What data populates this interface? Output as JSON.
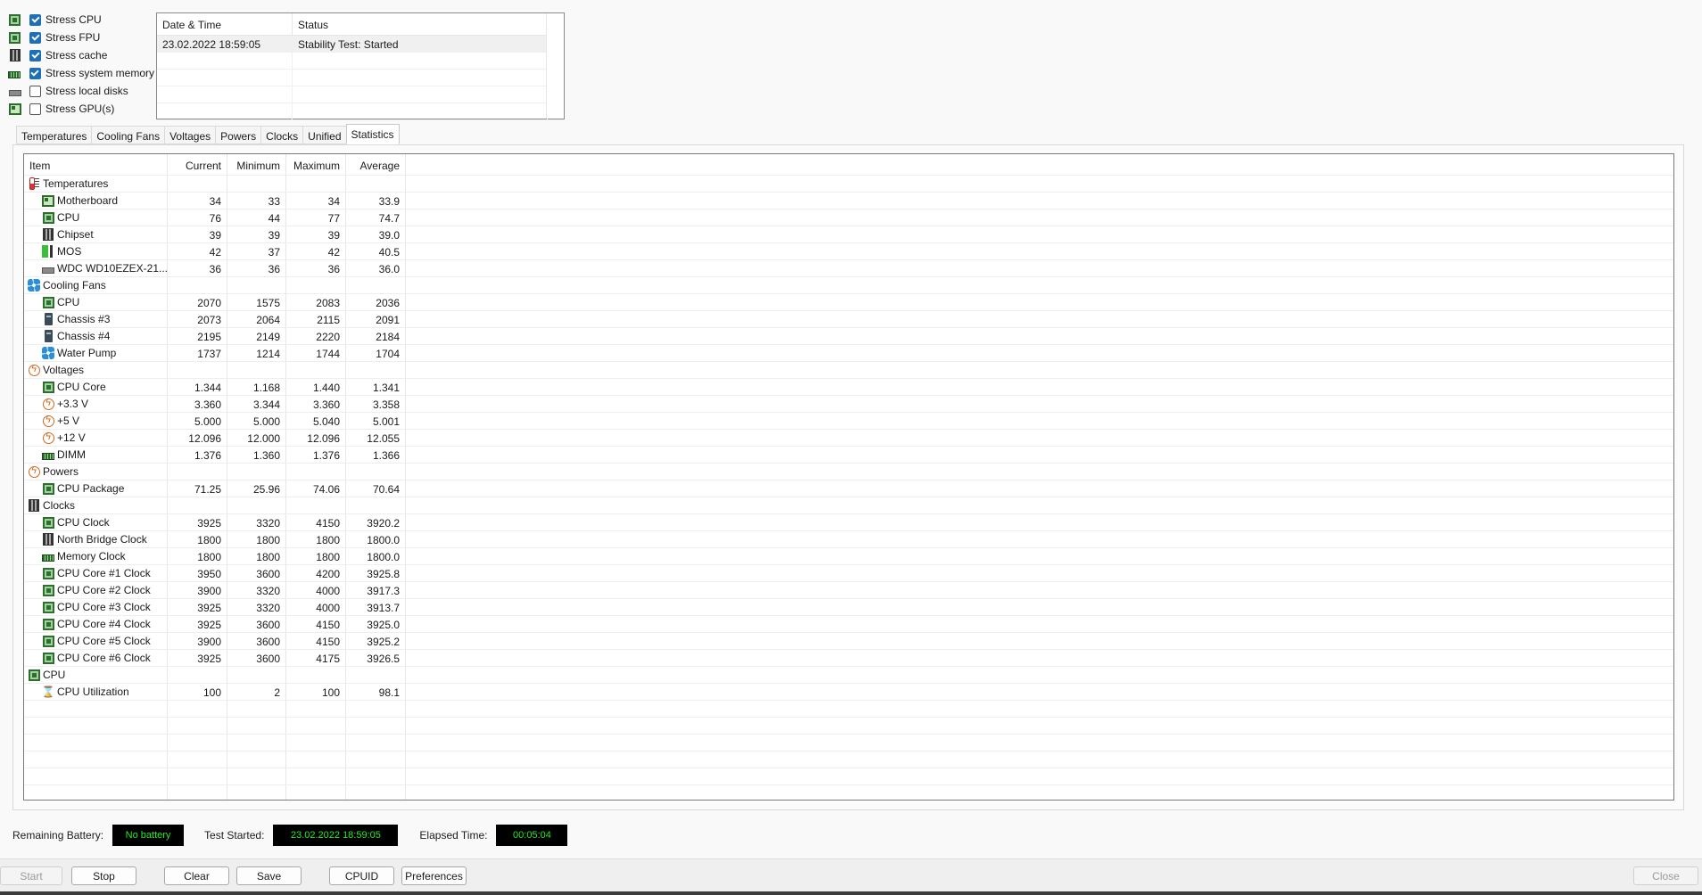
{
  "stress": [
    {
      "label": "Stress CPU",
      "checked": true,
      "icon": "cpu-icon"
    },
    {
      "label": "Stress FPU",
      "checked": true,
      "icon": "fpu-icon"
    },
    {
      "label": "Stress cache",
      "checked": true,
      "icon": "cache-icon"
    },
    {
      "label": "Stress system memory",
      "checked": true,
      "icon": "memory-icon"
    },
    {
      "label": "Stress local disks",
      "checked": false,
      "icon": "disk-icon"
    },
    {
      "label": "Stress GPU(s)",
      "checked": false,
      "icon": "gpu-icon"
    }
  ],
  "log": {
    "headers": {
      "date": "Date & Time",
      "status": "Status"
    },
    "rows": [
      {
        "date": "23.02.2022 18:59:05",
        "status": "Stability Test: Started"
      }
    ]
  },
  "tabs": [
    "Temperatures",
    "Cooling Fans",
    "Voltages",
    "Powers",
    "Clocks",
    "Unified",
    "Statistics"
  ],
  "active_tab": "Statistics",
  "stats": {
    "headers": {
      "item": "Item",
      "current": "Current",
      "minimum": "Minimum",
      "maximum": "Maximum",
      "average": "Average"
    },
    "rows": [
      {
        "level": 0,
        "icon": "thermometer-icon",
        "label": "Temperatures"
      },
      {
        "level": 1,
        "icon": "motherboard-icon",
        "label": "Motherboard",
        "cur": "34",
        "min": "33",
        "max": "34",
        "avg": "33.9"
      },
      {
        "level": 1,
        "icon": "cpu-icon",
        "label": "CPU",
        "cur": "76",
        "min": "44",
        "max": "77",
        "avg": "74.7"
      },
      {
        "level": 1,
        "icon": "chipset-icon",
        "label": "Chipset",
        "cur": "39",
        "min": "39",
        "max": "39",
        "avg": "39.0"
      },
      {
        "level": 1,
        "icon": "mos-icon",
        "label": "MOS",
        "cur": "42",
        "min": "37",
        "max": "42",
        "avg": "40.5"
      },
      {
        "level": 1,
        "icon": "disk-icon",
        "label": "WDC WD10EZEX-21...",
        "cur": "36",
        "min": "36",
        "max": "36",
        "avg": "36.0"
      },
      {
        "level": 0,
        "icon": "fan-icon",
        "label": "Cooling Fans"
      },
      {
        "level": 1,
        "icon": "cpu-icon",
        "label": "CPU",
        "cur": "2070",
        "min": "1575",
        "max": "2083",
        "avg": "2036"
      },
      {
        "level": 1,
        "icon": "case-icon",
        "label": "Chassis #3",
        "cur": "2073",
        "min": "2064",
        "max": "2115",
        "avg": "2091"
      },
      {
        "level": 1,
        "icon": "case-icon",
        "label": "Chassis #4",
        "cur": "2195",
        "min": "2149",
        "max": "2220",
        "avg": "2184"
      },
      {
        "level": 1,
        "icon": "fan-icon",
        "label": "Water Pump",
        "cur": "1737",
        "min": "1214",
        "max": "1744",
        "avg": "1704"
      },
      {
        "level": 0,
        "icon": "voltage-icon",
        "label": "Voltages"
      },
      {
        "level": 1,
        "icon": "cpu-icon",
        "label": "CPU Core",
        "cur": "1.344",
        "min": "1.168",
        "max": "1.440",
        "avg": "1.341"
      },
      {
        "level": 1,
        "icon": "voltage-icon",
        "label": "+3.3 V",
        "cur": "3.360",
        "min": "3.344",
        "max": "3.360",
        "avg": "3.358"
      },
      {
        "level": 1,
        "icon": "voltage-icon",
        "label": "+5 V",
        "cur": "5.000",
        "min": "5.000",
        "max": "5.040",
        "avg": "5.001"
      },
      {
        "level": 1,
        "icon": "voltage-icon",
        "label": "+12 V",
        "cur": "12.096",
        "min": "12.000",
        "max": "12.096",
        "avg": "12.055"
      },
      {
        "level": 1,
        "icon": "dimm-icon",
        "label": "DIMM",
        "cur": "1.376",
        "min": "1.360",
        "max": "1.376",
        "avg": "1.366"
      },
      {
        "level": 0,
        "icon": "voltage-icon",
        "label": "Powers"
      },
      {
        "level": 1,
        "icon": "cpu-icon",
        "label": "CPU Package",
        "cur": "71.25",
        "min": "25.96",
        "max": "74.06",
        "avg": "70.64"
      },
      {
        "level": 0,
        "icon": "chipset-icon",
        "label": "Clocks"
      },
      {
        "level": 1,
        "icon": "cpu-icon",
        "label": "CPU Clock",
        "cur": "3925",
        "min": "3320",
        "max": "4150",
        "avg": "3920.2"
      },
      {
        "level": 1,
        "icon": "chipset-icon",
        "label": "North Bridge Clock",
        "cur": "1800",
        "min": "1800",
        "max": "1800",
        "avg": "1800.0"
      },
      {
        "level": 1,
        "icon": "dimm-icon",
        "label": "Memory Clock",
        "cur": "1800",
        "min": "1800",
        "max": "1800",
        "avg": "1800.0"
      },
      {
        "level": 1,
        "icon": "cpu-icon",
        "label": "CPU Core #1 Clock",
        "cur": "3950",
        "min": "3600",
        "max": "4200",
        "avg": "3925.8"
      },
      {
        "level": 1,
        "icon": "cpu-icon",
        "label": "CPU Core #2 Clock",
        "cur": "3900",
        "min": "3320",
        "max": "4000",
        "avg": "3917.3"
      },
      {
        "level": 1,
        "icon": "cpu-icon",
        "label": "CPU Core #3 Clock",
        "cur": "3925",
        "min": "3320",
        "max": "4000",
        "avg": "3913.7"
      },
      {
        "level": 1,
        "icon": "cpu-icon",
        "label": "CPU Core #4 Clock",
        "cur": "3925",
        "min": "3600",
        "max": "4150",
        "avg": "3925.0"
      },
      {
        "level": 1,
        "icon": "cpu-icon",
        "label": "CPU Core #5 Clock",
        "cur": "3900",
        "min": "3600",
        "max": "4150",
        "avg": "3925.2"
      },
      {
        "level": 1,
        "icon": "cpu-icon",
        "label": "CPU Core #6 Clock",
        "cur": "3925",
        "min": "3600",
        "max": "4175",
        "avg": "3926.5"
      },
      {
        "level": 0,
        "icon": "cpu-icon",
        "label": "CPU"
      },
      {
        "level": 1,
        "icon": "hourglass-icon",
        "label": "CPU Utilization",
        "cur": "100",
        "min": "2",
        "max": "100",
        "avg": "98.1"
      }
    ]
  },
  "status": {
    "battery_label": "Remaining Battery:",
    "battery_value": "No battery",
    "started_label": "Test Started:",
    "started_value": "23.02.2022 18:59:05",
    "elapsed_label": "Elapsed Time:",
    "elapsed_value": "00:05:04"
  },
  "buttons": {
    "start": "Start",
    "stop": "Stop",
    "clear": "Clear",
    "save": "Save",
    "cpuid": "CPUID",
    "preferences": "Preferences",
    "close": "Close"
  },
  "colors": {
    "accent": "#1f6fb8",
    "status_fg": "#27e827",
    "status_bg": "#000000"
  }
}
